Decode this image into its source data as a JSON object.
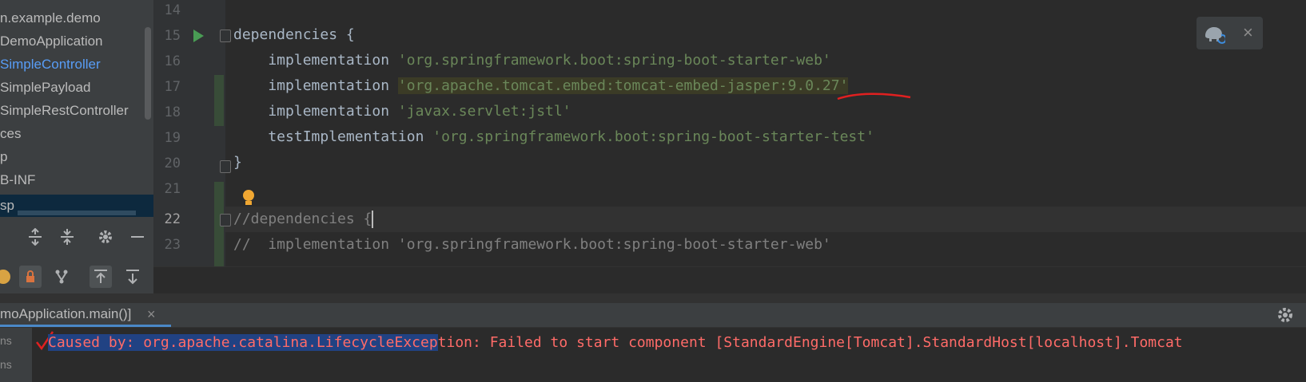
{
  "project_tree": {
    "items": [
      {
        "label": "n.example.demo"
      },
      {
        "label": "DemoApplication"
      },
      {
        "label": "SimpleController"
      },
      {
        "label": "SimplePayload"
      },
      {
        "label": "SimpleRestController"
      },
      {
        "label": "ces"
      },
      {
        "label": "p"
      },
      {
        "label": "B-INF"
      },
      {
        "label": "sp"
      }
    ]
  },
  "editor": {
    "line_numbers": [
      "14",
      "15",
      "16",
      "17",
      "18",
      "19",
      "20",
      "21",
      "22",
      "23"
    ],
    "lines": {
      "l15": {
        "kw": "dependencies {"
      },
      "l16": {
        "kw": "    implementation ",
        "str": "'org.springframework.boot:spring-boot-starter-web'"
      },
      "l17": {
        "kw": "    implementation ",
        "str": "'org.apache.tomcat.embed:tomcat-embed-jasper:9.0.27'"
      },
      "l18": {
        "kw": "    implementation ",
        "str": "'javax.servlet:jstl'"
      },
      "l19": {
        "kw": "    testImplementation ",
        "str": "'org.springframework.boot:spring-boot-starter-test'"
      },
      "l20": {
        "kw": "}"
      },
      "l22": {
        "comment": "//dependencies {"
      },
      "l23": {
        "comment": "//  implementation 'org.springframework.boot:spring-boot-starter-web'"
      }
    }
  },
  "run_panel": {
    "tab_label": "moApplication.main()]",
    "close_glyph": "×",
    "side_labels": [
      "ns",
      "ns"
    ],
    "console": {
      "selected_text": "Caused by: org.apache.catalina.LifecycleExcep",
      "rest_text": "tion: Failed to start component [StandardEngine[Tomcat].StandardHost[localhost].Tomcat"
    }
  },
  "notification": {
    "close_glyph": "×"
  },
  "colors": {
    "accent": "#4a88c7",
    "error_text": "#ff6b68",
    "string": "#6a8759",
    "annotation_red": "#e02020"
  },
  "icons": [
    "run-gutter-icon",
    "lightbulb-icon",
    "expand-all-icon",
    "collapse-all-icon",
    "gear-icon",
    "minimize-icon",
    "lock-icon",
    "branch-icon",
    "scroll-to-top-icon",
    "scroll-to-bottom-icon",
    "gradle-elephant-icon",
    "close-icon"
  ]
}
